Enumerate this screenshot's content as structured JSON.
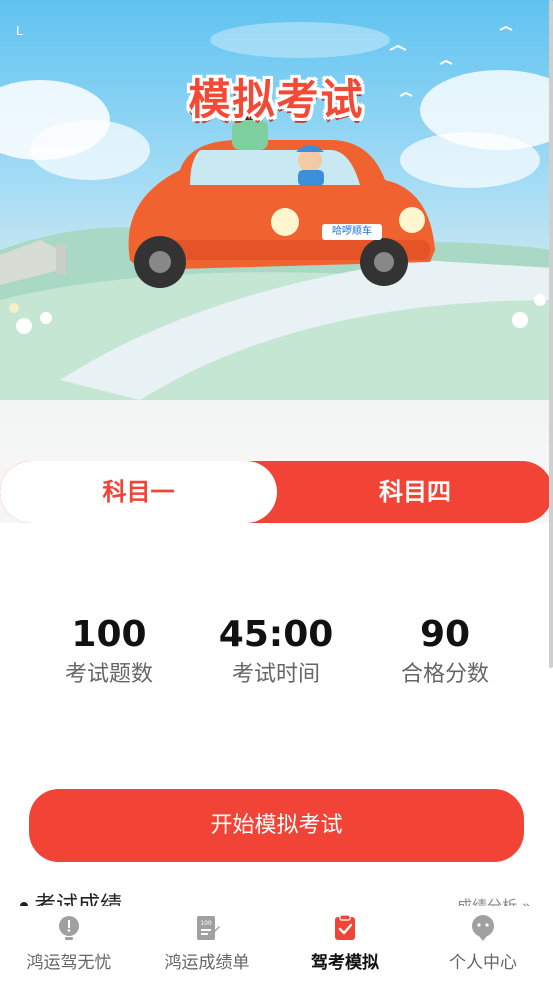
{
  "hero": {
    "title": "模拟考试",
    "plate_text": "哈啰顺车",
    "status_glyph": "L"
  },
  "tabs": [
    {
      "label": "科目一",
      "selected": true
    },
    {
      "label": "科目四",
      "selected": false
    }
  ],
  "stats": [
    {
      "value": "100",
      "label": "考试题数"
    },
    {
      "value": "45:00",
      "label": "考试时间"
    },
    {
      "value": "90",
      "label": "合格分数"
    }
  ],
  "start_button": {
    "label": "开始模拟考试"
  },
  "results_section": {
    "title": "考试成绩",
    "link": "成绩分析 »"
  },
  "nav": [
    {
      "label": "鸿运驾无忧",
      "icon": "bulb-icon",
      "active": false
    },
    {
      "label": "鸿运成绩单",
      "icon": "report-card-icon",
      "active": false
    },
    {
      "label": "驾考模拟",
      "icon": "exam-check-icon",
      "active": true
    },
    {
      "label": "个人中心",
      "icon": "profile-chat-icon",
      "active": false
    }
  ],
  "colors": {
    "accent": "#f24436",
    "active_nav": "#f24436",
    "inactive_nav": "#a0a0a0"
  }
}
